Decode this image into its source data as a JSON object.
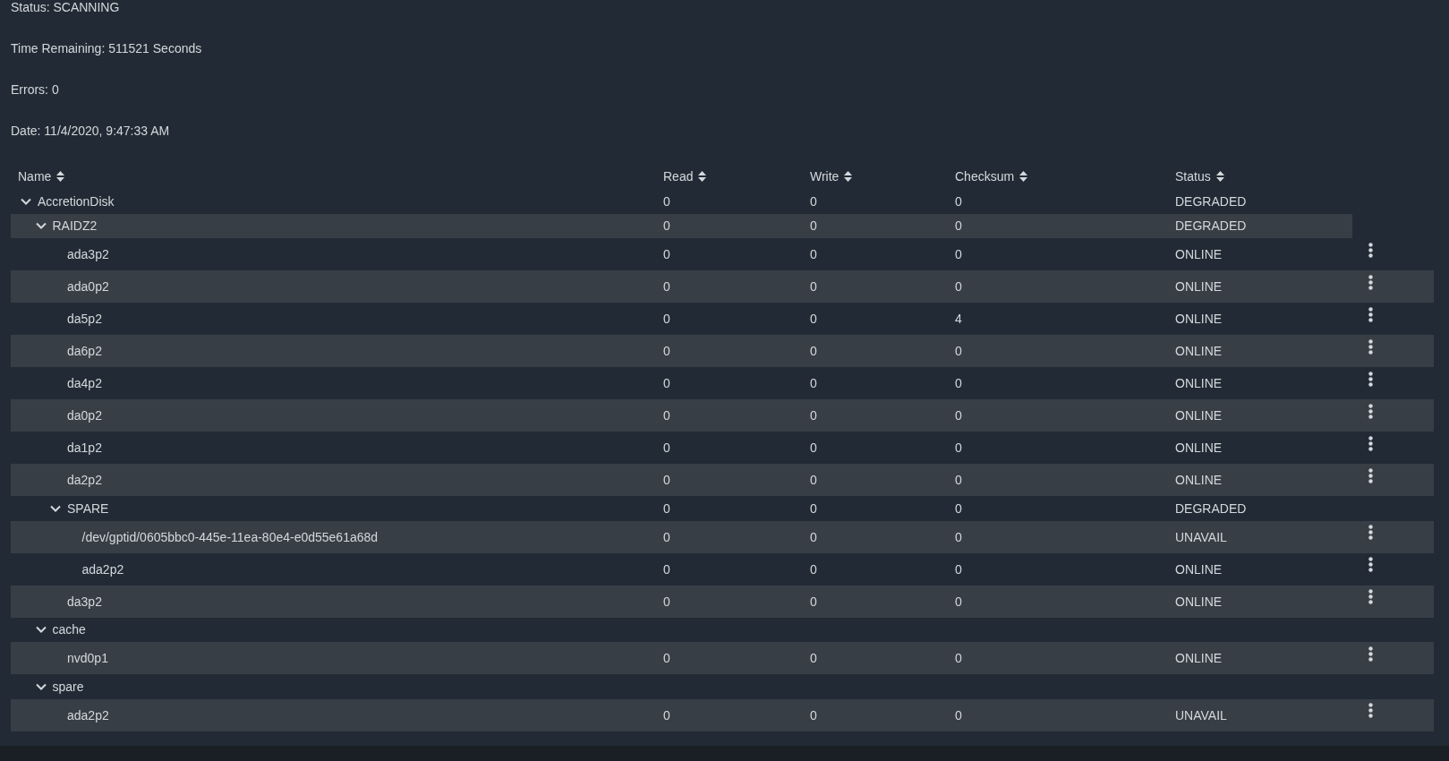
{
  "summary": [
    "Status: SCANNING",
    "Time Remaining: 511521 Seconds",
    "Errors: 0",
    "Date: 11/4/2020, 9:47:33 AM"
  ],
  "table": {
    "columns": [
      {
        "label": "Name"
      },
      {
        "label": "Read"
      },
      {
        "label": "Write"
      },
      {
        "label": "Checksum"
      },
      {
        "label": "Status"
      }
    ],
    "rows": [
      {
        "kind": "group",
        "name": "AccretionDisk",
        "read": "0",
        "write": "0",
        "checksum": "0",
        "status": "DEGRADED",
        "expanded": true,
        "children": [
          {
            "kind": "group",
            "name": "RAIDZ2",
            "read": "0",
            "write": "0",
            "checksum": "0",
            "status": "DEGRADED",
            "expanded": true,
            "children": [
              {
                "kind": "device",
                "name": "ada3p2",
                "read": "0",
                "write": "0",
                "checksum": "0",
                "status": "ONLINE"
              },
              {
                "kind": "device",
                "name": "ada0p2",
                "read": "0",
                "write": "0",
                "checksum": "0",
                "status": "ONLINE"
              },
              {
                "kind": "device",
                "name": "da5p2",
                "read": "0",
                "write": "0",
                "checksum": "4",
                "status": "ONLINE"
              },
              {
                "kind": "device",
                "name": "da6p2",
                "read": "0",
                "write": "0",
                "checksum": "0",
                "status": "ONLINE"
              },
              {
                "kind": "device",
                "name": "da4p2",
                "read": "0",
                "write": "0",
                "checksum": "0",
                "status": "ONLINE"
              },
              {
                "kind": "device",
                "name": "da0p2",
                "read": "0",
                "write": "0",
                "checksum": "0",
                "status": "ONLINE"
              },
              {
                "kind": "device",
                "name": "da1p2",
                "read": "0",
                "write": "0",
                "checksum": "0",
                "status": "ONLINE"
              },
              {
                "kind": "device",
                "name": "da2p2",
                "read": "0",
                "write": "0",
                "checksum": "0",
                "status": "ONLINE"
              },
              {
                "kind": "group",
                "name": "SPARE",
                "read": "0",
                "write": "0",
                "checksum": "0",
                "status": "DEGRADED",
                "expanded": true,
                "children": [
                  {
                    "kind": "device",
                    "name": "/dev/gptid/0605bbc0-445e-11ea-80e4-e0d55e61a68d",
                    "read": "0",
                    "write": "0",
                    "checksum": "0",
                    "status": "UNAVAIL"
                  },
                  {
                    "kind": "device",
                    "name": "ada2p2",
                    "read": "0",
                    "write": "0",
                    "checksum": "0",
                    "status": "ONLINE"
                  }
                ]
              },
              {
                "kind": "device",
                "name": "da3p2",
                "read": "0",
                "write": "0",
                "checksum": "0",
                "status": "ONLINE"
              }
            ]
          },
          {
            "kind": "group",
            "name": "cache",
            "expanded": true,
            "children": [
              {
                "kind": "device",
                "name": "nvd0p1",
                "read": "0",
                "write": "0",
                "checksum": "0",
                "status": "ONLINE"
              }
            ]
          },
          {
            "kind": "group",
            "name": "spare",
            "expanded": true,
            "children": [
              {
                "kind": "device",
                "name": "ada2p2",
                "read": "0",
                "write": "0",
                "checksum": "0",
                "status": "UNAVAIL"
              }
            ]
          }
        ]
      }
    ]
  }
}
